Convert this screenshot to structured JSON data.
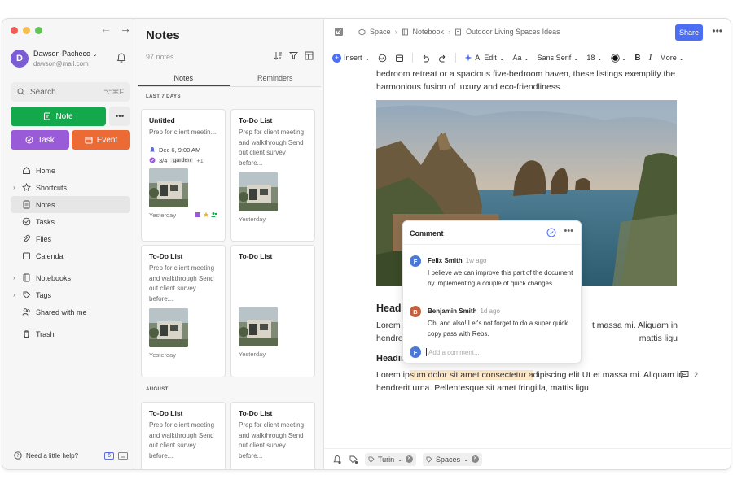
{
  "colors": {
    "accent": "#4c6ef5",
    "note_green": "#14a84c",
    "task_purple": "#9a5bd9",
    "event_orange": "#ec6b35"
  },
  "sidebar": {
    "user_name": "Dawson Pacheco",
    "user_email": "dawson@mail.com",
    "avatar_letter": "D",
    "search_placeholder": "Search",
    "search_shortcut": "⌥⌘F",
    "btn_note": "Note",
    "btn_task": "Task",
    "btn_event": "Event",
    "items": [
      {
        "label": "Home",
        "icon": "home-icon"
      },
      {
        "label": "Shortcuts",
        "icon": "star-icon"
      },
      {
        "label": "Notes",
        "icon": "note-icon"
      },
      {
        "label": "Tasks",
        "icon": "check-circle-icon"
      },
      {
        "label": "Files",
        "icon": "paperclip-icon"
      },
      {
        "label": "Calendar",
        "icon": "calendar-icon"
      },
      {
        "label": "Notebooks",
        "icon": "notebook-icon"
      },
      {
        "label": "Tags",
        "icon": "tag-icon"
      },
      {
        "label": "Shared with me",
        "icon": "people-icon"
      },
      {
        "label": "Trash",
        "icon": "trash-icon"
      }
    ],
    "help": "Need a little help?",
    "help_badge": "6"
  },
  "notes_list": {
    "title": "Notes",
    "count": "97 notes",
    "tab_notes": "Notes",
    "tab_reminders": "Reminders",
    "section_recent": "LAST 7 DAYS",
    "section_august": "AUGUST",
    "cards": [
      {
        "title": "Untitled",
        "snippet": "Prep for client meetin...",
        "reminder": "Dec 6, 9:00 AM",
        "progress": "3/4",
        "tag": "garden",
        "tag_more": "+1",
        "date": "Yesterday"
      },
      {
        "title": "To-Do List",
        "snippet": "Prep for client meeting and walkthrough Send out client survey before...",
        "date": "Yesterday"
      },
      {
        "title": "To-Do List",
        "snippet": "Prep for client meeting and walkthrough Send out client survey before...",
        "date": "Yesterday"
      },
      {
        "title": "To-Do List",
        "snippet": "",
        "date": "Yesterday"
      },
      {
        "title": "To-Do List",
        "snippet": "Prep for client meeting and walkthrough Send out client survey before...",
        "date": ""
      },
      {
        "title": "To-Do List",
        "snippet": "Prep for client meeting and walkthrough Send out client survey before...",
        "date": ""
      }
    ]
  },
  "editor": {
    "crumb_space": "Space",
    "crumb_notebook": "Notebook",
    "crumb_note": "Outdoor Living Spaces Ideas",
    "share": "Share",
    "toolbar": {
      "insert": "Insert",
      "ai_edit": "AI Edit",
      "font_size_label": "Aa",
      "font": "Sans Serif",
      "size": "18",
      "bold": "B",
      "italic": "I",
      "more": "More"
    },
    "intro_line1": "bedroom retreat or a spacious five-bedroom haven, these listings exemplify the",
    "intro_line2": "harmonious fusion of luxury and eco-friendliness.",
    "heading1": "Headi",
    "para1_line1_start": "Lorem i",
    "para1_line1_end": "t massa mi. Aliquam in",
    "para1_line2_start": "hendrer",
    "para1_line2_end": "mattis ligu",
    "heading2": "Headin",
    "para2_line1_a": "Lorem ip",
    "para2_line1_highlight": "sum dolor sit amet consectetur a",
    "para2_line1_b": "dipiscing elit Ut et massa mi. Aliquam in",
    "para2_line2": "hendrerit urna. Pellentesque sit amet fringilla, mattis ligu",
    "comment_count": "2",
    "footer_chip1": "Turin",
    "footer_chip2": "Spaces"
  },
  "comment_panel": {
    "title": "Comment",
    "entries": [
      {
        "initial": "F",
        "name": "Felix Smith",
        "time": "1w ago",
        "text": "I believe we can improve this part of the document by implementing a couple of quick changes.",
        "color": "#4c78d6"
      },
      {
        "initial": "B",
        "name": "Benjamin Smith",
        "time": "1d ago",
        "text": "Oh, and also! Let's not forget to do a super quick copy pass with Rebs.",
        "color": "#c0623f"
      }
    ],
    "add_placeholder": "Add a comment...",
    "self_initial": "F"
  }
}
